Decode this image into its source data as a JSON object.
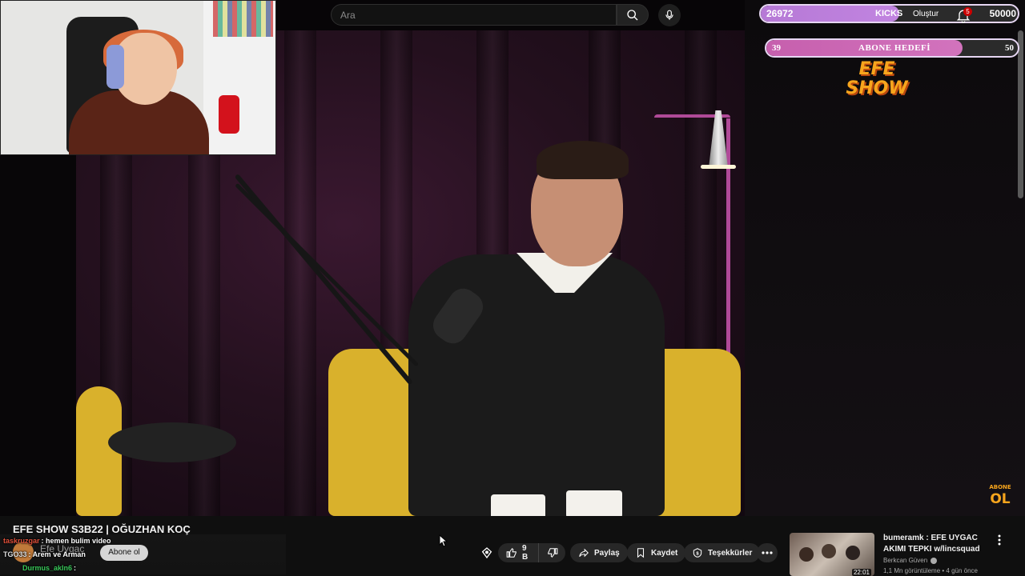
{
  "search": {
    "placeholder": "Ara"
  },
  "overlay": {
    "kicks": {
      "count": "26972",
      "label": "KICKS",
      "goal": "50000",
      "progress": 0.54
    },
    "subscriber_goal": {
      "current": "39",
      "label": "ABONE HEDEFİ",
      "goal": "50",
      "progress": 0.78
    }
  },
  "header": {
    "create_label": "Oluştur",
    "notification_count": "5"
  },
  "logos": {
    "efe_show_top": "EFE",
    "efe_show_bottom": "SHOW",
    "abone_top": "ABONE",
    "abone_bottom": "OL"
  },
  "video": {
    "title": "EFE SHOW S3B22 | OĞUZHAN KOÇ",
    "channel_name": "Efe Uygaç",
    "subscribe_label": "Abone ol"
  },
  "chat": [
    {
      "user": "taskruzgar",
      "message": ": hemen bulim video",
      "color": "#e0503a"
    },
    {
      "user": "TGO33",
      "message": ": Arem ve Arman",
      "color": "#e0e0e0"
    },
    {
      "user": "Durmus_akln6",
      "message": ":",
      "color": "#39c85a"
    }
  ],
  "actions": {
    "like_count": "9 B",
    "share_label": "Paylaş",
    "save_label": "Kaydet",
    "thanks_label": "Teşekkürler"
  },
  "recommendation": {
    "title": "bumeramk : EFE UYGAC AKIMI TEPKI w/lincsquad",
    "channel": "Berkcan Güven",
    "meta": "1,1 Mn görüntüleme • 4 gün önce",
    "duration": "22:01"
  },
  "colors": {
    "accent_purple": "#b679d6",
    "accent_pink": "#c65fad",
    "brand_orange": "#f7a51d"
  }
}
